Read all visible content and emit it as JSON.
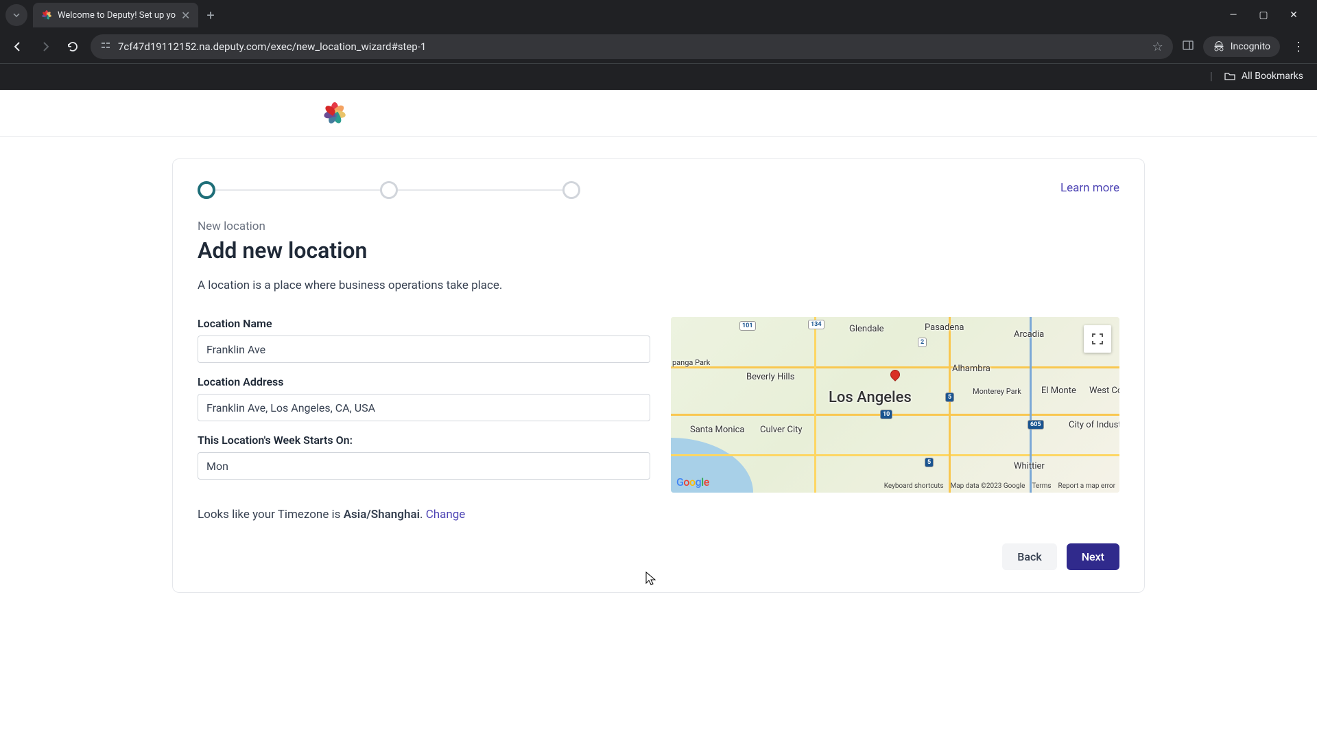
{
  "browser": {
    "tab_title": "Welcome to Deputy! Set up yo",
    "url": "7cf47d19112152.na.deputy.com/exec/new_location_wizard#step-1",
    "incognito_label": "Incognito",
    "all_bookmarks": "All Bookmarks"
  },
  "wizard": {
    "learn_more": "Learn more",
    "eyebrow": "New location",
    "title": "Add new location",
    "description": "A location is a place where business operations take place.",
    "labels": {
      "name": "Location Name",
      "address": "Location Address",
      "week_start": "This Location's Week Starts On:"
    },
    "values": {
      "name": "Franklin Ave",
      "address": "Franklin Ave, Los Angeles, CA, USA",
      "week_start": "Mon"
    },
    "timezone_prefix": "Looks like your Timezone is ",
    "timezone_value": "Asia/Shanghai",
    "timezone_suffix": ". ",
    "timezone_change": "Change",
    "back": "Back",
    "next": "Next"
  },
  "map": {
    "center_label": "Los Angeles",
    "labels": [
      "Glendale",
      "Pasadena",
      "Arcadia",
      "Alhambra",
      "Beverly Hills",
      "Monterey Park",
      "El Monte",
      "West Co",
      "Santa Monica",
      "Culver City",
      "City of Industry",
      "Whittier",
      "panga Park"
    ],
    "shields": [
      "101",
      "134",
      "2",
      "5",
      "10",
      "605",
      "5"
    ],
    "footer": {
      "shortcuts": "Keyboard shortcuts",
      "attribution": "Map data ©2023 Google",
      "terms": "Terms",
      "report": "Report a map error"
    }
  }
}
